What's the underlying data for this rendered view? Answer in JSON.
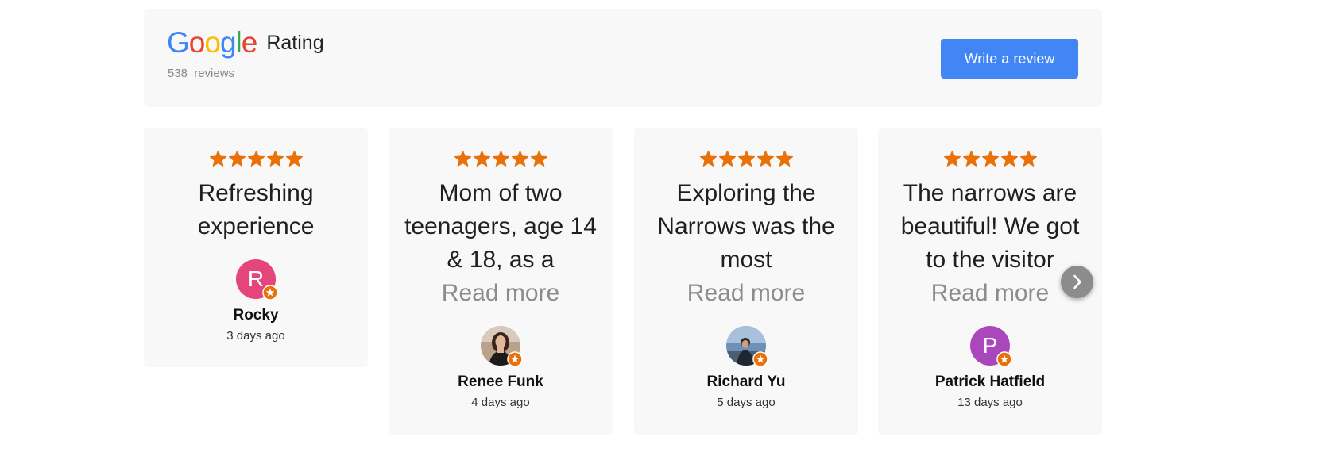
{
  "header": {
    "logo_letters": [
      "G",
      "o",
      "o",
      "g",
      "l",
      "e"
    ],
    "logo_colors": [
      "#4285f4",
      "#ea4335",
      "#fbbc05",
      "#4285f4",
      "#34a853",
      "#ea4335"
    ],
    "rating_label": "Rating",
    "review_count": "538 reviews",
    "write_review_label": "Write a review",
    "accent": "#4285f4"
  },
  "star_color": "#e8710a",
  "reviews": [
    {
      "rating": 5,
      "text": "Refreshing experience",
      "read_more": "",
      "reviewer": "Rocky",
      "date": "3 days ago",
      "avatar": {
        "type": "initial",
        "initial": "R",
        "color": "#e4457a"
      }
    },
    {
      "rating": 5,
      "text": "Mom of two teenagers, age 14 & 18, as a",
      "read_more": "Read more",
      "reviewer": "Renee Funk",
      "date": "4 days ago",
      "avatar": {
        "type": "photo",
        "icon": "woman-portrait-photo"
      }
    },
    {
      "rating": 5,
      "text": "Exploring the Narrows was the most",
      "read_more": "Read more",
      "reviewer": "Richard Yu",
      "date": "5 days ago",
      "avatar": {
        "type": "photo",
        "icon": "man-outdoor-photo"
      }
    },
    {
      "rating": 5,
      "text": "The narrows are beautiful! We got to the visitor",
      "read_more": "Read more",
      "reviewer": "Patrick Hatfield",
      "date": "13 days ago",
      "avatar": {
        "type": "initial",
        "initial": "P",
        "color": "#ab47bc"
      }
    }
  ],
  "icons": {
    "next": "chevron-right-icon",
    "badge": "local-guide-star-icon"
  }
}
